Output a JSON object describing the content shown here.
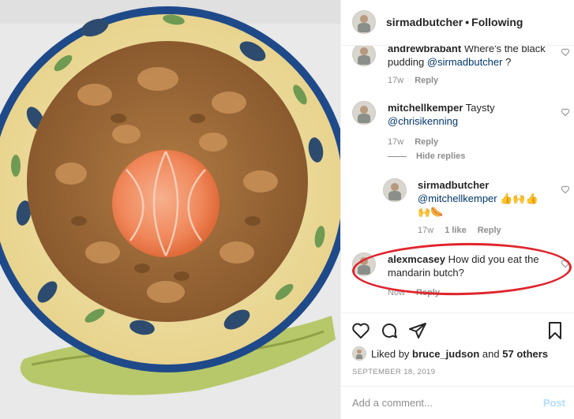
{
  "header": {
    "username": "sirmadbutcher",
    "separator": "•",
    "follow_status": "Following"
  },
  "comments": [
    {
      "username": "andrewbrabant",
      "text": "Where's the black pudding",
      "mention": "@sirmadbutcher",
      "tail": "?",
      "age": "17w",
      "reply_label": "Reply"
    },
    {
      "username": "mitchellkemper",
      "text": "Taysty",
      "mention": "@chrisikenning",
      "age": "17w",
      "reply_label": "Reply",
      "hide_replies_label": "Hide replies"
    },
    {
      "username": "sirmadbutcher",
      "mention": "@mitchellkemper",
      "emoji_line1": "👍🙌👍",
      "emoji_line2": "🙌🌭",
      "age": "17w",
      "likes": "1 like",
      "reply_label": "Reply"
    },
    {
      "username": "alexmcasey",
      "text": "How did you eat the mandarin butch?",
      "age": "Now",
      "reply_label": "Reply"
    }
  ],
  "actions": {
    "liked_by_prefix": "Liked by",
    "liked_by_user": "bruce_judson",
    "liked_by_joiner": "and",
    "liked_by_others": "57 others",
    "date": "SEPTEMBER 18, 2019"
  },
  "add_comment": {
    "placeholder": "Add a comment...",
    "post_label": "Post"
  },
  "icons": [
    "heart-icon",
    "comment-icon",
    "share-icon",
    "bookmark-icon"
  ],
  "colors": {
    "link": "#00376b",
    "muted": "#8e8e8e",
    "post_disabled": "#b2dffc",
    "highlight_ring": "#e0242c"
  }
}
